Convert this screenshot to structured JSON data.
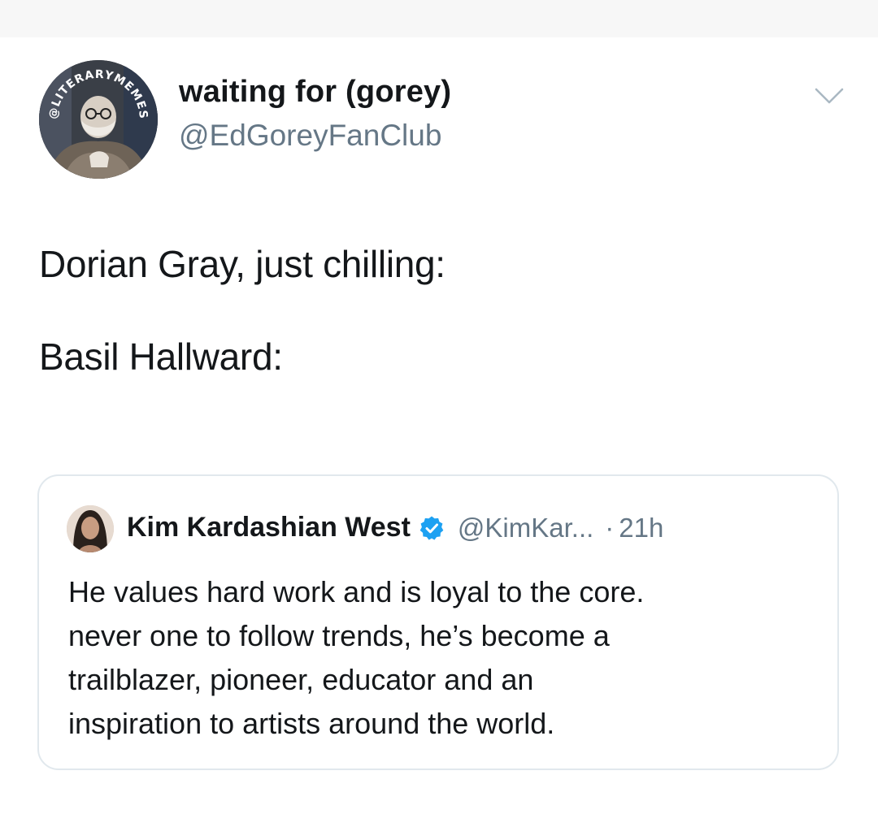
{
  "tweet": {
    "display_name": "waiting for (gorey)",
    "handle": "@EdGoreyFanClub",
    "avatar_badge_text": "@LITERARYMEMES",
    "text_lines": [
      "Dorian Gray, just chilling:",
      "Basil Hallward:"
    ],
    "menu_icon": "chevron-down-icon"
  },
  "quoted_tweet": {
    "display_name": "Kim Kardashian West",
    "verified": true,
    "handle": "@KimKar...",
    "separator": "·",
    "time": "21h",
    "text": "He values hard work and is loyal  to the core.\nnever one to follow trends, he’s become a\ntrailblazer, pioneer, educator and an\ninspiration to artists around the world."
  },
  "colors": {
    "text_primary": "#14171a",
    "text_secondary": "#657786",
    "verified_blue": "#1da1f2",
    "card_border": "#e1e8ed"
  }
}
